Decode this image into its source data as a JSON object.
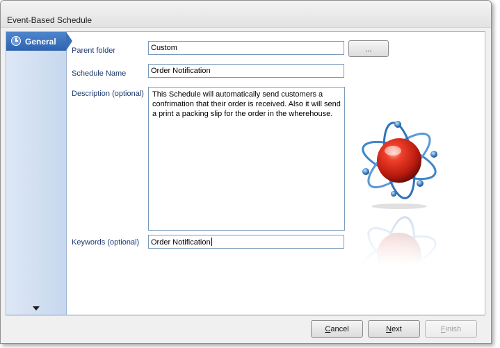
{
  "window": {
    "title": "Event-Based Schedule"
  },
  "nav": {
    "items": [
      {
        "label": "General",
        "icon": "clock-icon",
        "selected": true
      }
    ]
  },
  "form": {
    "parent_folder": {
      "label": "Parent folder",
      "value": "Custom",
      "browse_label": "..."
    },
    "schedule_name": {
      "label": "Schedule Name",
      "value": "Order Notification"
    },
    "description": {
      "label": "Description (optional)",
      "value": "This Schedule will automatically send customers a confrimation that their order is received. Also it will send a print a packing slip for the order in the wherehouse."
    },
    "keywords": {
      "label": "Keywords (optional)",
      "value": "Order Notification"
    }
  },
  "footer": {
    "cancel": {
      "prefix": "",
      "underlined": "C",
      "suffix": "ancel"
    },
    "next": {
      "prefix": "",
      "underlined": "N",
      "suffix": "ext"
    },
    "finish": {
      "prefix": "",
      "underlined": "F",
      "suffix": "inish",
      "disabled": true
    }
  },
  "colors": {
    "nav_selected": "#2d63ae",
    "label_text": "#1e3a6e",
    "field_border": "#7a9bbd",
    "atom_core": "#d42a1a",
    "atom_orbit": "#3f86c8"
  }
}
